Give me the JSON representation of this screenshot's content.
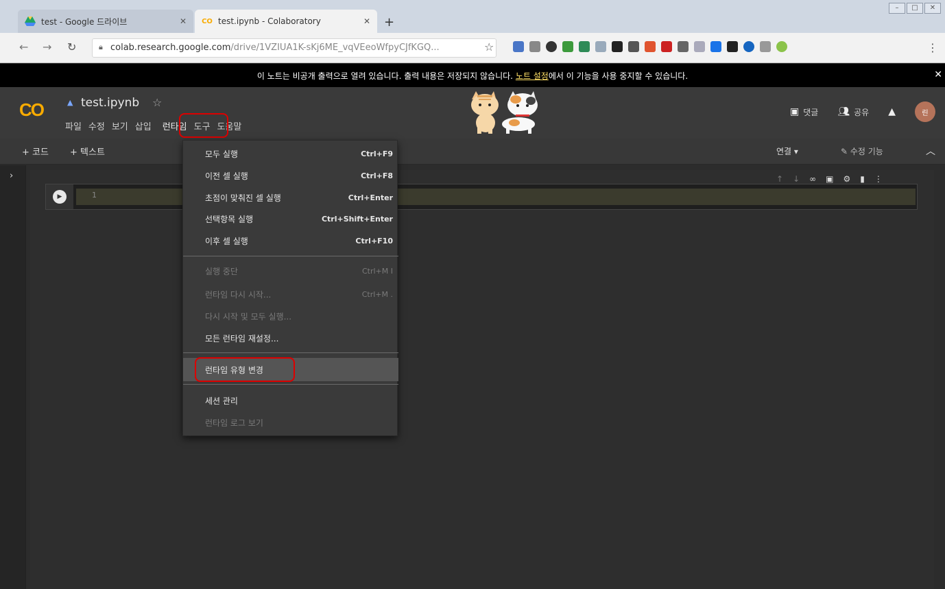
{
  "browser": {
    "tabs": [
      {
        "title": "test - Google 드라이브",
        "active": false,
        "favicon": "drive-icon"
      },
      {
        "title": "test.ipynb - Colaboratory",
        "active": true,
        "favicon": "colab-icon"
      }
    ],
    "new_tab_label": "+",
    "url_host": "colab.research.google.com",
    "url_path": "/drive/1VZIUA1K-sKj6ME_vqVEeoWfpyCJfKGQ..."
  },
  "notice": {
    "text_before": "이 노트는 비공개 출력으로 열려 있습니다. 출력 내용은 저장되지 않습니다. ",
    "link": "노트 설정",
    "text_after": "에서 이 기능을 사용 중지할 수 있습니다."
  },
  "header": {
    "logo": "CO",
    "notebook_title": "test.ipynb",
    "menus": [
      "파일",
      "수정",
      "보기",
      "삽입",
      "런타임",
      "도구",
      "도움말"
    ],
    "comment_label": "댓글",
    "share_label": "공유",
    "avatar_initial": "린"
  },
  "toolbar": {
    "add_code": "+ 코드",
    "add_text": "+ 텍스트",
    "connect": "연결 ▾",
    "edit_mode": "수정 기능"
  },
  "cell": {
    "line_number": "1"
  },
  "runtime_menu": {
    "items": [
      {
        "label": "모두 실행",
        "shortcut": "Ctrl+F9",
        "disabled": false
      },
      {
        "label": "이전 셀 실행",
        "shortcut": "Ctrl+F8",
        "disabled": false
      },
      {
        "label": "초점이 맞춰진 셀 실행",
        "shortcut": "Ctrl+Enter",
        "disabled": false
      },
      {
        "label": "선택항목 실행",
        "shortcut": "Ctrl+Shift+Enter",
        "disabled": false
      },
      {
        "label": "이후 셀 실행",
        "shortcut": "Ctrl+F10",
        "disabled": false
      },
      {
        "label": "실행 중단",
        "shortcut": "Ctrl+M I",
        "disabled": true
      },
      {
        "label": "런타임 다시 시작...",
        "shortcut": "Ctrl+M .",
        "disabled": true
      },
      {
        "label": "다시 시작 및 모두 실행...",
        "shortcut": "",
        "disabled": true
      },
      {
        "label": "모든 런타임 재설정...",
        "shortcut": "",
        "disabled": false
      },
      {
        "label": "런타임 유형 변경",
        "shortcut": "",
        "disabled": false,
        "highlighted": true
      },
      {
        "label": "세션 관리",
        "shortcut": "",
        "disabled": false
      },
      {
        "label": "런타임 로그 보기",
        "shortcut": "",
        "disabled": true
      }
    ]
  },
  "colors": {
    "accent": "#f9ab00",
    "highlight_border": "#dd0000",
    "background": "#2b2b2b"
  }
}
